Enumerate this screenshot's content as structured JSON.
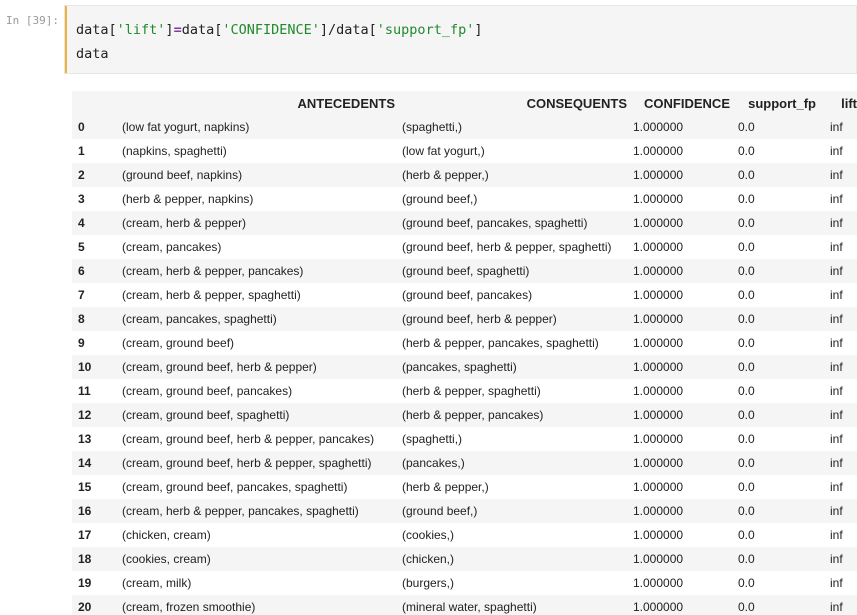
{
  "cell": {
    "prompt": "In [39]:",
    "code_line1_parts": [
      "data[",
      "'lift'",
      "]",
      "=",
      "data[",
      "'CONFIDENCE'",
      "]/data[",
      "'support_fp'",
      "]"
    ],
    "code_line2": "data"
  },
  "table": {
    "columns": [
      "",
      "ANTECEDENTS",
      "CONSEQUENTS",
      "CONFIDENCE",
      "support_fp",
      "lift"
    ],
    "rows": [
      [
        "0",
        "(low fat yogurt, napkins)",
        "(spaghetti,)",
        "1.000000",
        "0.0",
        "inf"
      ],
      [
        "1",
        "(napkins, spaghetti)",
        "(low fat yogurt,)",
        "1.000000",
        "0.0",
        "inf"
      ],
      [
        "2",
        "(ground beef, napkins)",
        "(herb & pepper,)",
        "1.000000",
        "0.0",
        "inf"
      ],
      [
        "3",
        "(herb & pepper, napkins)",
        "(ground beef,)",
        "1.000000",
        "0.0",
        "inf"
      ],
      [
        "4",
        "(cream, herb & pepper)",
        "(ground beef, pancakes, spaghetti)",
        "1.000000",
        "0.0",
        "inf"
      ],
      [
        "5",
        "(cream, pancakes)",
        "(ground beef, herb & pepper, spaghetti)",
        "1.000000",
        "0.0",
        "inf"
      ],
      [
        "6",
        "(cream, herb & pepper, pancakes)",
        "(ground beef, spaghetti)",
        "1.000000",
        "0.0",
        "inf"
      ],
      [
        "7",
        "(cream, herb & pepper, spaghetti)",
        "(ground beef, pancakes)",
        "1.000000",
        "0.0",
        "inf"
      ],
      [
        "8",
        "(cream, pancakes, spaghetti)",
        "(ground beef, herb & pepper)",
        "1.000000",
        "0.0",
        "inf"
      ],
      [
        "9",
        "(cream, ground beef)",
        "(herb & pepper, pancakes, spaghetti)",
        "1.000000",
        "0.0",
        "inf"
      ],
      [
        "10",
        "(cream, ground beef, herb & pepper)",
        "(pancakes, spaghetti)",
        "1.000000",
        "0.0",
        "inf"
      ],
      [
        "11",
        "(cream, ground beef, pancakes)",
        "(herb & pepper, spaghetti)",
        "1.000000",
        "0.0",
        "inf"
      ],
      [
        "12",
        "(cream, ground beef, spaghetti)",
        "(herb & pepper, pancakes)",
        "1.000000",
        "0.0",
        "inf"
      ],
      [
        "13",
        "(cream, ground beef, herb & pepper, pancakes)",
        "(spaghetti,)",
        "1.000000",
        "0.0",
        "inf"
      ],
      [
        "14",
        "(cream, ground beef, herb & pepper, spaghetti)",
        "(pancakes,)",
        "1.000000",
        "0.0",
        "inf"
      ],
      [
        "15",
        "(cream, ground beef, pancakes, spaghetti)",
        "(herb & pepper,)",
        "1.000000",
        "0.0",
        "inf"
      ],
      [
        "16",
        "(cream, herb & pepper, pancakes, spaghetti)",
        "(ground beef,)",
        "1.000000",
        "0.0",
        "inf"
      ],
      [
        "17",
        "(chicken, cream)",
        "(cookies,)",
        "1.000000",
        "0.0",
        "inf"
      ],
      [
        "18",
        "(cookies, cream)",
        "(chicken,)",
        "1.000000",
        "0.0",
        "inf"
      ],
      [
        "19",
        "(cream, milk)",
        "(burgers,)",
        "1.000000",
        "0.0",
        "inf"
      ],
      [
        "20",
        "(cream, frozen smoothie)",
        "(mineral water, spaghetti)",
        "1.000000",
        "0.0",
        "inf"
      ]
    ]
  },
  "colors": {
    "cell_background": "#f5f5f5",
    "cell_accent": "#f0b33a",
    "string_literal": "#1f8a2c",
    "operator": "#7a3e9d",
    "prompt": "#9a9a9a"
  }
}
